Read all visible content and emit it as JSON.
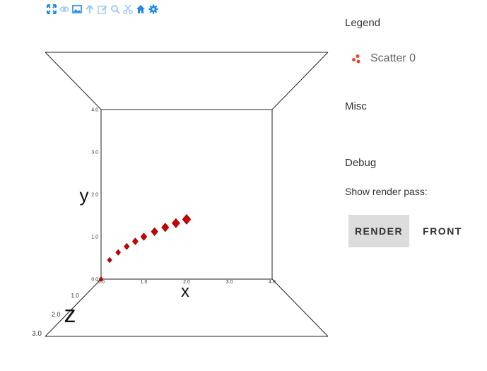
{
  "toolbar": {
    "icons": [
      "fullscreen-icon",
      "eye-icon",
      "image-icon",
      "arrow-up-icon",
      "edit-icon",
      "zoom-icon",
      "scissors-icon",
      "home-icon",
      "gear-icon"
    ],
    "colors": {
      "active": "#1e88e5",
      "muted": "#90caf9"
    }
  },
  "chart_data": {
    "type": "scatter",
    "projection": "3d",
    "axes": {
      "x": {
        "label": "x",
        "range": [
          0,
          4
        ],
        "ticks": [
          "0.0",
          "1.0",
          "2.0",
          "3.0",
          "4.0"
        ]
      },
      "y": {
        "label": "y",
        "range": [
          0,
          4
        ],
        "ticks": [
          "0.0",
          "1.0",
          "2.0",
          "3.0",
          "4.0"
        ]
      },
      "z": {
        "label": "z",
        "range": [
          0,
          3
        ],
        "ticks": [
          "1.0",
          "2.0",
          "3.0"
        ]
      }
    },
    "series": [
      {
        "name": "Scatter 0",
        "color": "#cc0000",
        "marker": "diamond",
        "points": [
          {
            "x": 0.0,
            "y": 0.0,
            "z": 0
          },
          {
            "x": 0.2,
            "y": 0.45,
            "z": 0
          },
          {
            "x": 0.4,
            "y": 0.63,
            "z": 0
          },
          {
            "x": 0.6,
            "y": 0.77,
            "z": 0
          },
          {
            "x": 0.8,
            "y": 0.89,
            "z": 0
          },
          {
            "x": 1.0,
            "y": 1.0,
            "z": 0
          },
          {
            "x": 1.25,
            "y": 1.12,
            "z": 0
          },
          {
            "x": 1.5,
            "y": 1.22,
            "z": 0
          },
          {
            "x": 1.75,
            "y": 1.32,
            "z": 0
          },
          {
            "x": 2.0,
            "y": 1.41,
            "z": 0
          }
        ]
      }
    ],
    "grid": false
  },
  "panel": {
    "legend_title": "Legend",
    "legend_entries": [
      {
        "label": "Scatter 0",
        "color": "#f44336"
      }
    ],
    "misc_title": "Misc",
    "debug_title": "Debug",
    "render_pass_label": "Show render pass:",
    "render_button": "RENDER",
    "front_button": "FRONT"
  }
}
